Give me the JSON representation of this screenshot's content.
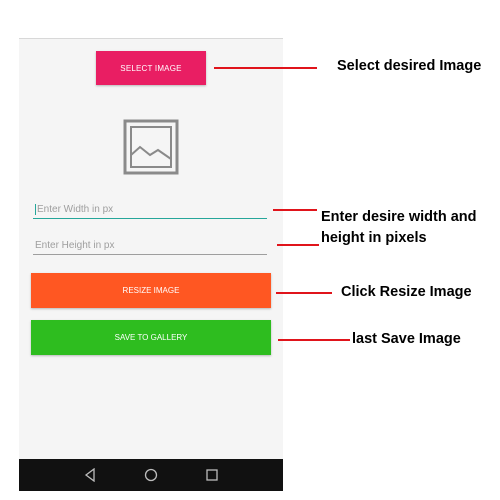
{
  "app": {
    "select_image_label": "SELECT IMAGE",
    "image_placeholder_icon": "image-placeholder-icon",
    "width_field": {
      "placeholder": "Enter Width in px",
      "value": ""
    },
    "height_field": {
      "placeholder": "Enter Height in px",
      "value": ""
    },
    "resize_label": "RESIZE IMAGE",
    "save_label": "SAVE TO GALLERY"
  },
  "navbar": {
    "icons": [
      "back-icon",
      "home-icon",
      "recents-icon"
    ]
  },
  "annotations": {
    "select": "Select desired Image",
    "dims_line1": "Enter desire width and",
    "dims_line2": "height in pixels",
    "resize": "Click Resize Image",
    "save": "last Save Image"
  },
  "colors": {
    "select_button": "#e91e63",
    "resize_button": "#ff5722",
    "save_button": "#2ebd1f",
    "field_focus": "#26a69a",
    "annotation_line": "#e0141b"
  }
}
